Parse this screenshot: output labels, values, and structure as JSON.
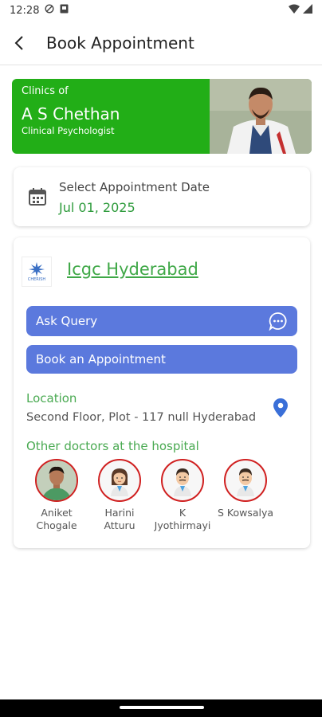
{
  "status_bar": {
    "time": "12:28"
  },
  "app_bar": {
    "title": "Book Appointment"
  },
  "clinic_banner": {
    "heading": "Clinics of",
    "doctor_name": "A S Chethan",
    "doctor_title": "Clinical Psychologist",
    "background_color": "#22ae17"
  },
  "date_card": {
    "label": "Select Appointment Date",
    "value": "Jul 01, 2025"
  },
  "hospital": {
    "name": "Icgc Hyderabad",
    "logo_text": "CHERISH",
    "ask_query_label": "Ask Query",
    "book_label": "Book an Appointment",
    "location_label": "Location",
    "location_value": "Second Floor, Plot - 117 null Hyderabad",
    "other_doctors_label": "Other doctors at the hospital",
    "other_doctors": [
      {
        "name_line1": "Aniket",
        "name_line2": "Chogale",
        "avatar": "photo"
      },
      {
        "name_line1": "Harini",
        "name_line2": "Atturu",
        "avatar": "female-doctor-icon"
      },
      {
        "name_line1": "K",
        "name_line2": "Jyothirmayi",
        "avatar": "male-doctor-icon"
      },
      {
        "name_line1": "S Kowsalya",
        "name_line2": "",
        "avatar": "male-doctor-icon"
      }
    ]
  },
  "colors": {
    "accent_green": "#22ae17",
    "button_blue": "#5b79dd",
    "link_green": "#3fa847",
    "avatar_ring": "#d02020"
  }
}
